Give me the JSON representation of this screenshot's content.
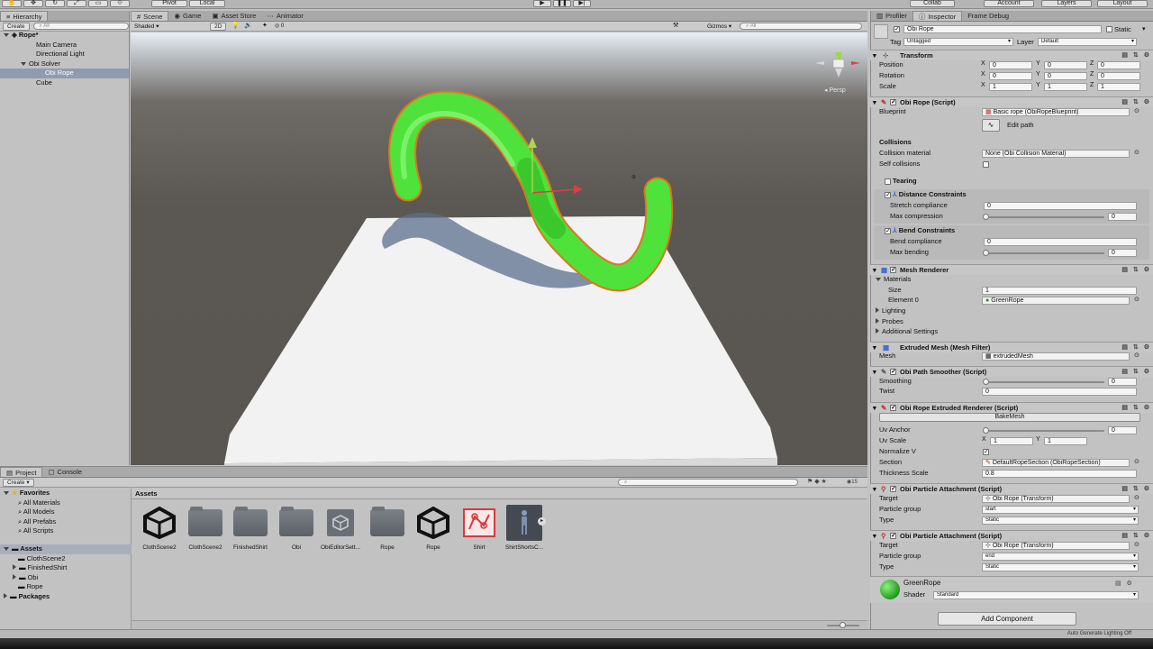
{
  "toolbar": {
    "pivot": "Pivot",
    "local": "Local",
    "collab": "Collab",
    "account": "Account",
    "layers": "Layers",
    "layout": "Layout"
  },
  "hierarchy": {
    "tab": "Hierarchy",
    "create": "Create",
    "search_placeholder": "All",
    "scene": "Rope*",
    "items": [
      "Main Camera",
      "Directional Light",
      "Obi Solver",
      "Obi Rope",
      "Cube"
    ]
  },
  "scene_view": {
    "tabs": [
      "Scene",
      "Game",
      "Asset Store",
      "Animator"
    ],
    "shading": "Shaded",
    "mode_2d": "2D",
    "fx_count": "0",
    "gizmos": "Gizmos",
    "search_placeholder": "All",
    "persp": "Persp"
  },
  "project": {
    "tabs": [
      "Project",
      "Console"
    ],
    "create": "Create",
    "favorites": "Favorites",
    "favorite_items": [
      "All Materials",
      "All Models",
      "All Prefabs",
      "All Scripts"
    ],
    "assets_root": "Assets",
    "asset_tree": [
      "ClothScene2",
      "FinishedShirt",
      "Obi",
      "Rope"
    ],
    "packages": "Packages",
    "breadcrumb": "Assets",
    "badge_count": "15",
    "assets": [
      {
        "name": "ClothScene2",
        "kind": "unity"
      },
      {
        "name": "ClothScene2",
        "kind": "folder"
      },
      {
        "name": "FinishedShirt",
        "kind": "folder"
      },
      {
        "name": "Obi",
        "kind": "folder"
      },
      {
        "name": "ObiEditorSett...",
        "kind": "settings"
      },
      {
        "name": "Rope",
        "kind": "folder"
      },
      {
        "name": "Rope",
        "kind": "unity"
      },
      {
        "name": "Shirt",
        "kind": "blueprint"
      },
      {
        "name": "ShirtShortsC...",
        "kind": "figure"
      }
    ]
  },
  "inspector": {
    "tabs": [
      "Profiler",
      "Inspector",
      "Frame Debug"
    ],
    "object_name": "Obi Rope",
    "static_label": "Static",
    "tag_label": "Tag",
    "tag_value": "Untagged",
    "layer_label": "Layer",
    "layer_value": "Default",
    "transform": {
      "title": "Transform",
      "rows": [
        {
          "label": "Position",
          "x": "0",
          "y": "0",
          "z": "0"
        },
        {
          "label": "Rotation",
          "x": "0",
          "y": "0",
          "z": "0"
        },
        {
          "label": "Scale",
          "x": "1",
          "y": "1",
          "z": "1"
        }
      ]
    },
    "obi_rope": {
      "title": "Obi Rope (Script)",
      "blueprint_label": "Blueprint",
      "blueprint_value": "Basic rope (ObiRopeBlueprint)",
      "edit_path": "Edit path",
      "collisions": "Collisions",
      "collision_material_label": "Collision material",
      "collision_material_value": "None (Obi Collision Material)",
      "self_collisions": "Self collisions",
      "tearing": "Tearing",
      "distance_constraints": "Distance Constraints",
      "stretch_compliance_label": "Stretch compliance",
      "stretch_compliance_value": "0",
      "max_compression_label": "Max compression",
      "max_compression_value": "0",
      "bend_constraints": "Bend Constraints",
      "bend_compliance_label": "Bend compliance",
      "bend_compliance_value": "0",
      "max_bending_label": "Max bending",
      "max_bending_value": "0"
    },
    "mesh_renderer": {
      "title": "Mesh Renderer",
      "materials": "Materials",
      "size_label": "Size",
      "size_value": "1",
      "element_label": "Element 0",
      "element_value": "GreenRope",
      "lighting": "Lighting",
      "probes": "Probes",
      "additional": "Additional Settings"
    },
    "mesh_filter": {
      "title": "Extruded Mesh (Mesh Filter)",
      "mesh_label": "Mesh",
      "mesh_value": "extrudedMesh"
    },
    "path_smoother": {
      "title": "Obi Path Smoother (Script)",
      "smoothing_label": "Smoothing",
      "smoothing_value": "0",
      "twist_label": "Twist",
      "twist_value": "0"
    },
    "extruded_renderer": {
      "title": "Obi Rope Extruded Renderer (Script)",
      "bake_button": "BakeMesh",
      "uv_anchor_label": "Uv Anchor",
      "uv_anchor_value": "0",
      "uv_scale_label": "Uv Scale",
      "uv_scale_x": "1",
      "uv_scale_y": "1",
      "normalize_label": "Normalize V",
      "section_label": "Section",
      "section_value": "DefaultRopeSection (ObiRopeSection)",
      "thickness_label": "Thickness Scale",
      "thickness_value": "0.8"
    },
    "attachment1": {
      "title": "Obi Particle Attachment (Script)",
      "target_label": "Target",
      "target_value": "Obi Rope (Transform)",
      "group_label": "Particle group",
      "group_value": "start",
      "type_label": "Type",
      "type_value": "Static"
    },
    "attachment2": {
      "title": "Obi Particle Attachment (Script)",
      "target_label": "Target",
      "target_value": "Obi Rope (Transform)",
      "group_label": "Particle group",
      "group_value": "end",
      "type_label": "Type",
      "type_value": "Static"
    },
    "material": {
      "name": "GreenRope",
      "shader_label": "Shader",
      "shader_value": "Standard"
    },
    "add_component": "Add Component"
  },
  "status": {
    "lighting": "Auto Generate Lighting Off"
  },
  "colors": {
    "rope_green": "#4ee23a",
    "rope_outline": "#e87a2a",
    "selection": "#8f9bb0"
  }
}
